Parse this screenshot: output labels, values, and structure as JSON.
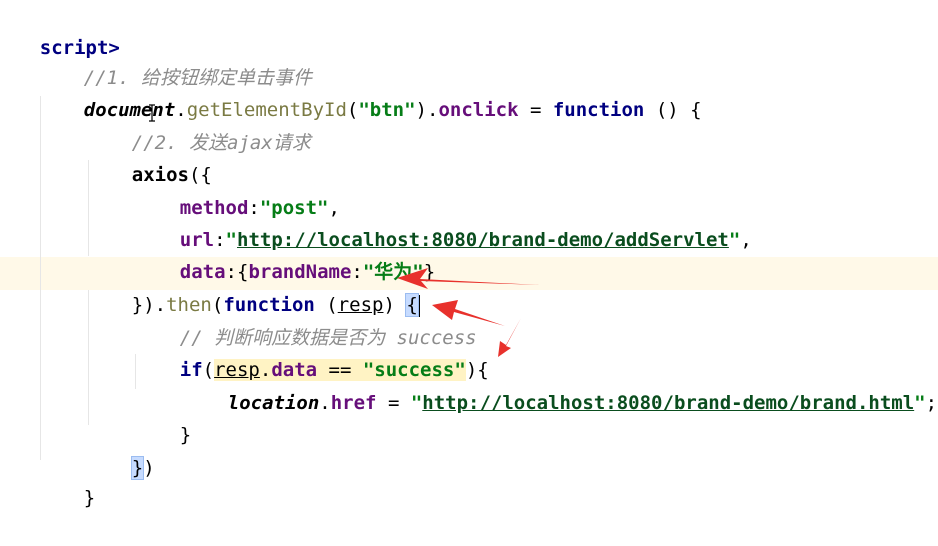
{
  "code": {
    "line0": {
      "tag": "script>"
    },
    "line1": {
      "comment": "//1. 给按钮绑定单击事件"
    },
    "line2": {
      "obj": "document",
      "dot1": ".",
      "method": "getElementById",
      "open": "(",
      "arg": "\"btn\"",
      "close": ")",
      "dot2": ".",
      "prop": "onclick",
      "eq": " = ",
      "kw": "function",
      "rest": " () {"
    },
    "line3": {
      "comment": "//2. 发送ajax请求"
    },
    "line4": {
      "name": "axios",
      "rest": "({"
    },
    "line5": {
      "key": "method",
      "colon": ":",
      "value": "\"post\"",
      "comma": ","
    },
    "line6": {
      "key": "url",
      "colon": ":",
      "q1": "\"",
      "url": "http://localhost:8080/brand-demo/addServlet",
      "q2": "\"",
      "comma": ","
    },
    "line7": {
      "key": "data",
      "colon": ":",
      "open": "{",
      "innerKey": "brandName",
      "colon2": ":",
      "value": "\"华为\"",
      "close": "}"
    },
    "line8": {
      "close": "}).",
      "then": "then",
      "open": "(",
      "kw": "function",
      "params": " (",
      "param": "resp",
      "pclose": ") ",
      "brace": "{"
    },
    "line9": {
      "comment": "// 判断响应数据是否为 success"
    },
    "line10": {
      "kw": "if",
      "open": "(",
      "var": "resp",
      "dot": ".",
      "prop": "data",
      "op": " == ",
      "str": "\"success\"",
      "close": "){"
    },
    "line11": {
      "obj": "location",
      "dot": ".",
      "prop": "href",
      "eq": " = ",
      "q1": "\"",
      "url": "http://localhost:8080/brand-demo/brand.html",
      "q2": "\"",
      "semi": ";"
    },
    "line12": {
      "brace": "}"
    },
    "line13": {
      "brace": "}",
      "paren": ")"
    },
    "line14": {
      "brace": "}"
    }
  },
  "colors": {
    "keyword": "#000080",
    "string": "#067d17",
    "comment": "#8c8c8c",
    "annotation_arrow": "#e8312c",
    "paren_match": "#c6dbff"
  }
}
